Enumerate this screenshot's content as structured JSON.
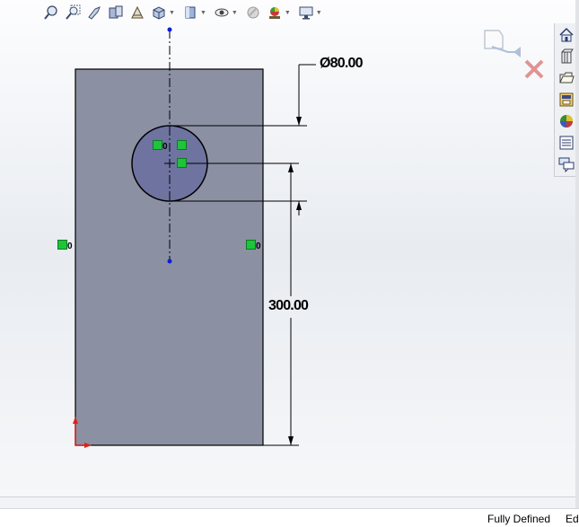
{
  "toolbar": {
    "items": [
      {
        "icon": "zoom-to-fit-icon"
      },
      {
        "icon": "zoom-to-area-icon"
      },
      {
        "icon": "previous-view-icon"
      },
      {
        "icon": "section-view-icon"
      },
      {
        "icon": "dynamic-annotation-views-icon"
      },
      {
        "icon": "view-orientation-icon"
      },
      {
        "icon": "display-style-icon"
      },
      {
        "icon": "hide-show-items-icon"
      },
      {
        "icon": "edit-appearance-icon"
      },
      {
        "icon": "apply-scene-icon"
      },
      {
        "icon": "view-settings-icon"
      }
    ]
  },
  "task_pane": {
    "items": [
      {
        "icon": "home-icon"
      },
      {
        "icon": "design-library-icon"
      },
      {
        "icon": "file-explorer-icon"
      },
      {
        "icon": "view-palette-icon"
      },
      {
        "icon": "appearances-icon"
      },
      {
        "icon": "custom-properties-icon"
      },
      {
        "icon": "forum-icon"
      }
    ]
  },
  "sketch": {
    "diameter_dimension": "Ø80.00",
    "vertical_dimension": "300.00",
    "relation_marker_label": "0"
  },
  "colors": {
    "body_fill": "#8c90a3",
    "circle_fill": "#6f73a0",
    "relation_green": "#1ec43a",
    "point_blue": "#0a1fd6",
    "origin_red": "#e0201a"
  },
  "status_bar": {
    "state": "Fully Defined",
    "mode": "Edi"
  }
}
